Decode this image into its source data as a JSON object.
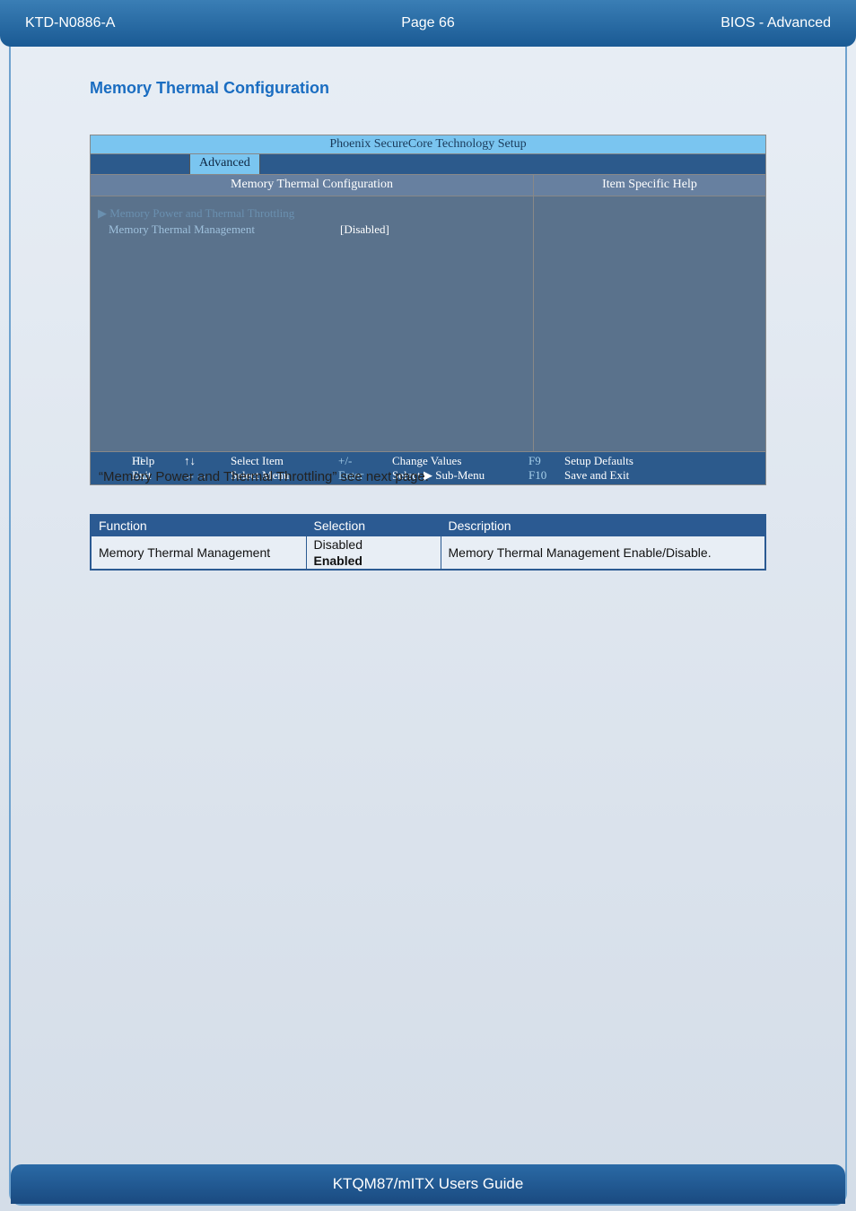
{
  "header": {
    "doc_id": "KTD-N0886-A",
    "page_label": "Page 66",
    "section": "BIOS  - Advanced"
  },
  "section_title": "Memory Thermal Configuration",
  "bios": {
    "title": "Phoenix SecureCore Technology Setup",
    "active_tab": "Advanced",
    "left_heading": "Memory Thermal Configuration",
    "right_heading": "Item Specific Help",
    "menu_submenu": "▶ Memory Power and Thermal Throttling",
    "menu_item_label": "Memory Thermal Management",
    "menu_item_value": "[Disabled]",
    "footer": {
      "r1": {
        "k1": "F1",
        "l1": "Help",
        "a1": "↑↓",
        "m1": "Select Item",
        "e1": "+/-",
        "c1": "Change Values",
        "f1": "F9",
        "s1": "Setup Defaults"
      },
      "r2": {
        "k1": "Esc",
        "l1": "Exit",
        "a1": "←→",
        "m1": "Select Menu",
        "e1": "Enter",
        "c1": "Select ▶ Sub-Menu",
        "f1": "F10",
        "s1": "Save and Exit"
      }
    }
  },
  "caption": "“Memory Power and Thermal Throttling” see next page.",
  "table": {
    "headers": {
      "c1": "Function",
      "c2": "Selection",
      "c3": "Description"
    },
    "row": {
      "func": "Memory Thermal Management",
      "sel1": "Disabled",
      "sel2": "Enabled",
      "desc": "Memory Thermal Management Enable/Disable."
    }
  },
  "footer_title": "KTQM87/mITX Users Guide"
}
